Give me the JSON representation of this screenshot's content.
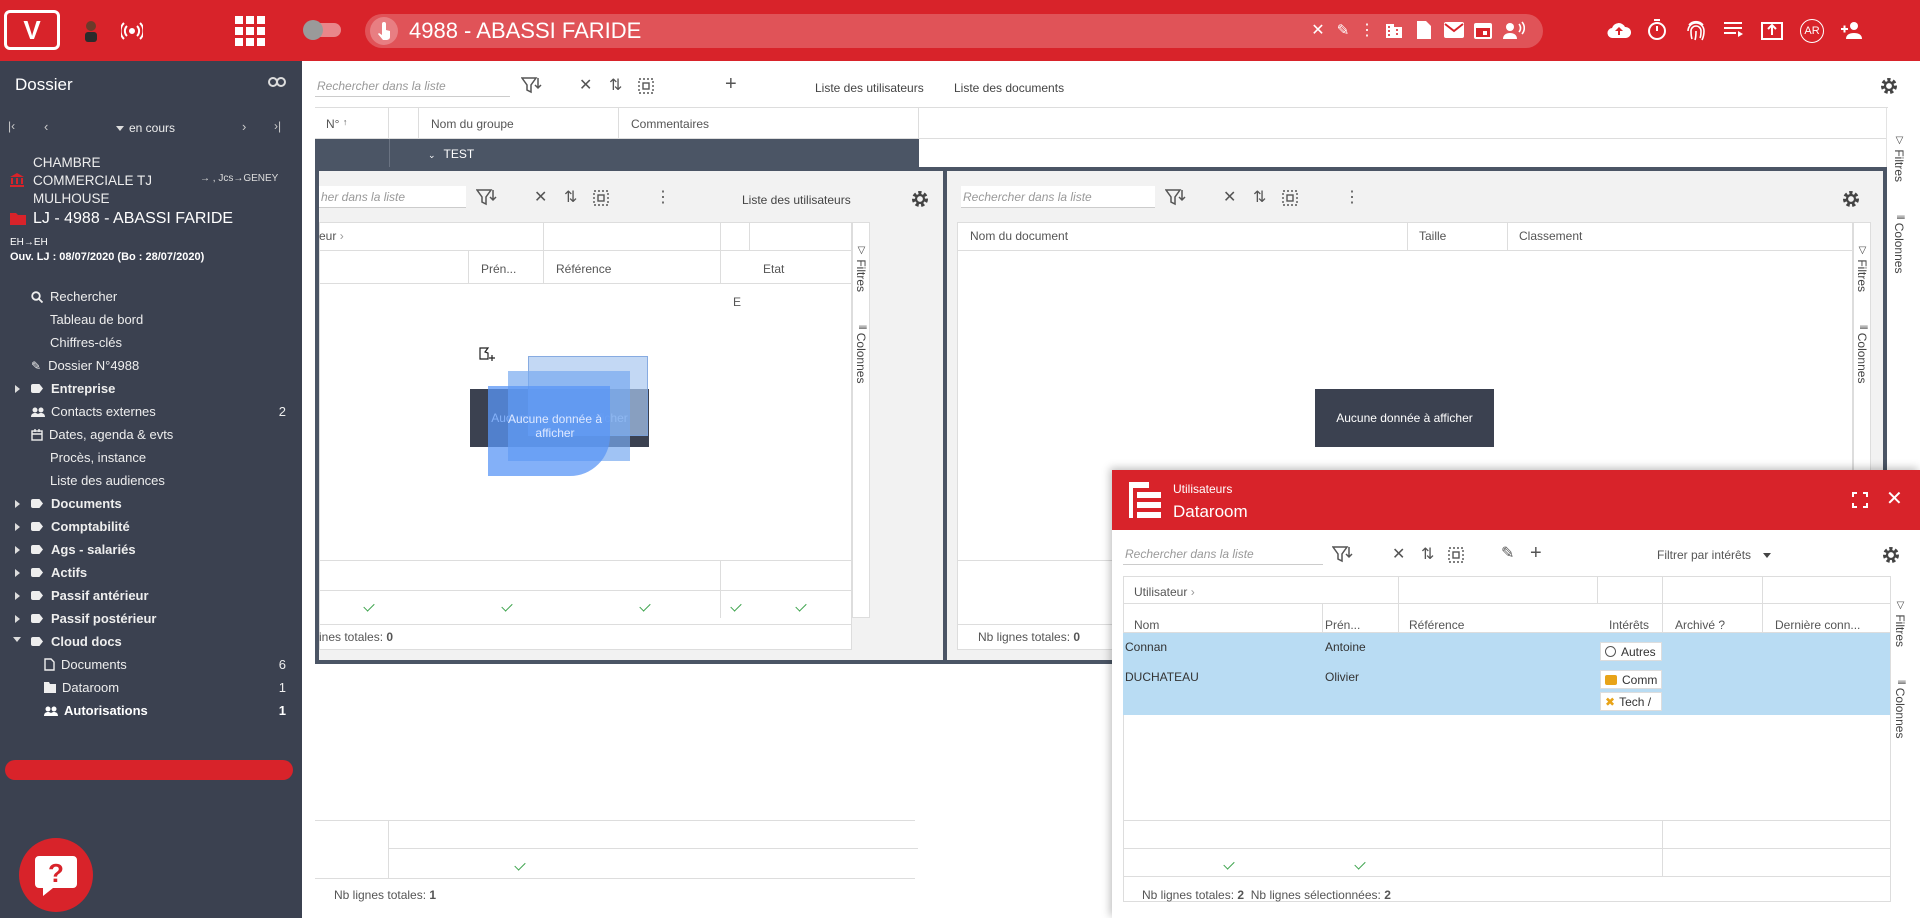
{
  "topbar": {
    "logo": "V",
    "dossier_title": "4988 - ABASSI FARIDE",
    "user_badge": "AR",
    "icons": [
      "avatar-icon",
      "wifi-icon",
      "apps-grid-icon",
      "toggle-switch",
      "touch-icon",
      "clear-icon",
      "edit-icon",
      "more-vert-icon",
      "building-icon",
      "document-icon",
      "mail-icon",
      "calendar-icon",
      "voice-icon",
      "cloud-upload-icon",
      "timer-icon",
      "fingerprint-icon",
      "list-icon",
      "export-icon",
      "user-badge",
      "add-user-icon"
    ]
  },
  "sidebar": {
    "title": "Dossier",
    "status_select": "en cours",
    "court": "CHAMBRE COMMERCIALE TJ MULHOUSE",
    "court_right": "→ , Jcs→GENEY",
    "procedure": "LJ - 4988 - ABASSI FARIDE",
    "eh_line": "EH→EH",
    "opening_line": "Ouv. LJ : 08/07/2020 (Bo : 28/07/2020)",
    "items": [
      {
        "label": "Rechercher",
        "count": ""
      },
      {
        "label": "Tableau de bord",
        "count": ""
      },
      {
        "label": "Chiffres-clés",
        "count": ""
      },
      {
        "label": "Dossier N°4988",
        "count": ""
      },
      {
        "label": "Entreprise",
        "count": ""
      },
      {
        "label": "Contacts externes",
        "count": "2"
      },
      {
        "label": "Dates, agenda & evts",
        "count": ""
      },
      {
        "label": "Procès, instance",
        "count": ""
      },
      {
        "label": "Liste des audiences",
        "count": ""
      },
      {
        "label": "Documents",
        "count": ""
      },
      {
        "label": "Comptabilité",
        "count": ""
      },
      {
        "label": "Ags - salariés",
        "count": ""
      },
      {
        "label": "Actifs",
        "count": ""
      },
      {
        "label": "Passif antérieur",
        "count": ""
      },
      {
        "label": "Passif postérieur",
        "count": ""
      },
      {
        "label": "Cloud docs",
        "count": ""
      },
      {
        "label": "Documents",
        "count": "6"
      },
      {
        "label": "Dataroom",
        "count": "1"
      },
      {
        "label": "Autorisations",
        "count": "1"
      }
    ]
  },
  "main": {
    "search_placeholder": "Rechercher dans la liste",
    "link_users": "Liste des utilisateurs",
    "link_documents": "Liste des documents",
    "columns": [
      "N°",
      "Nom du groupe",
      "Commentaires"
    ],
    "group_row": "TEST",
    "filters": "Filtres",
    "colonnes": "Colonnes",
    "totals_label": "Nb lignes totales:",
    "totals_value": "1",
    "left_panel": {
      "search_placeholder": "her dans la liste",
      "link": "Liste des utilisateurs",
      "group_header": "eur",
      "columns": [
        "Prén...",
        "Référence",
        "Etat"
      ],
      "cell_e": "E",
      "nodata": "Aucune donnée à afficher",
      "totals_label": "ines totales:",
      "totals_value": "0"
    },
    "right_panel": {
      "search_placeholder": "Rechercher dans la liste",
      "columns": [
        "Nom du document",
        "Taille",
        "Classement"
      ],
      "nodata": "Aucune donnée à afficher",
      "totals_label": "Nb lignes totales:",
      "totals_value": "0"
    }
  },
  "dialog": {
    "subtitle": "Utilisateurs",
    "title": "Dataroom",
    "search_placeholder": "Rechercher dans la liste",
    "filter_interests": "Filtrer par intérêts",
    "group_header": "Utilisateur",
    "columns": [
      "Nom",
      "Prén...",
      "Référence",
      "Intérêts",
      "Archivé ?",
      "Dernière conn..."
    ],
    "rows": [
      {
        "nom": "Connan",
        "prenom": "Antoine",
        "interets": [
          "Autres"
        ]
      },
      {
        "nom": "DUCHATEAU",
        "prenom": "Olivier",
        "interets": [
          "Comm",
          "Tech /"
        ]
      }
    ],
    "totals_label": "Nb lignes totales:",
    "totals_value": "2",
    "selected_label": "Nb lignes sélectionnées:",
    "selected_value": "2",
    "filters": "Filtres",
    "colonnes": "Colonnes"
  },
  "colors": {
    "accent": "#d8232a",
    "sidebar": "#3b4150",
    "selected_row": "#b9dcf3"
  }
}
